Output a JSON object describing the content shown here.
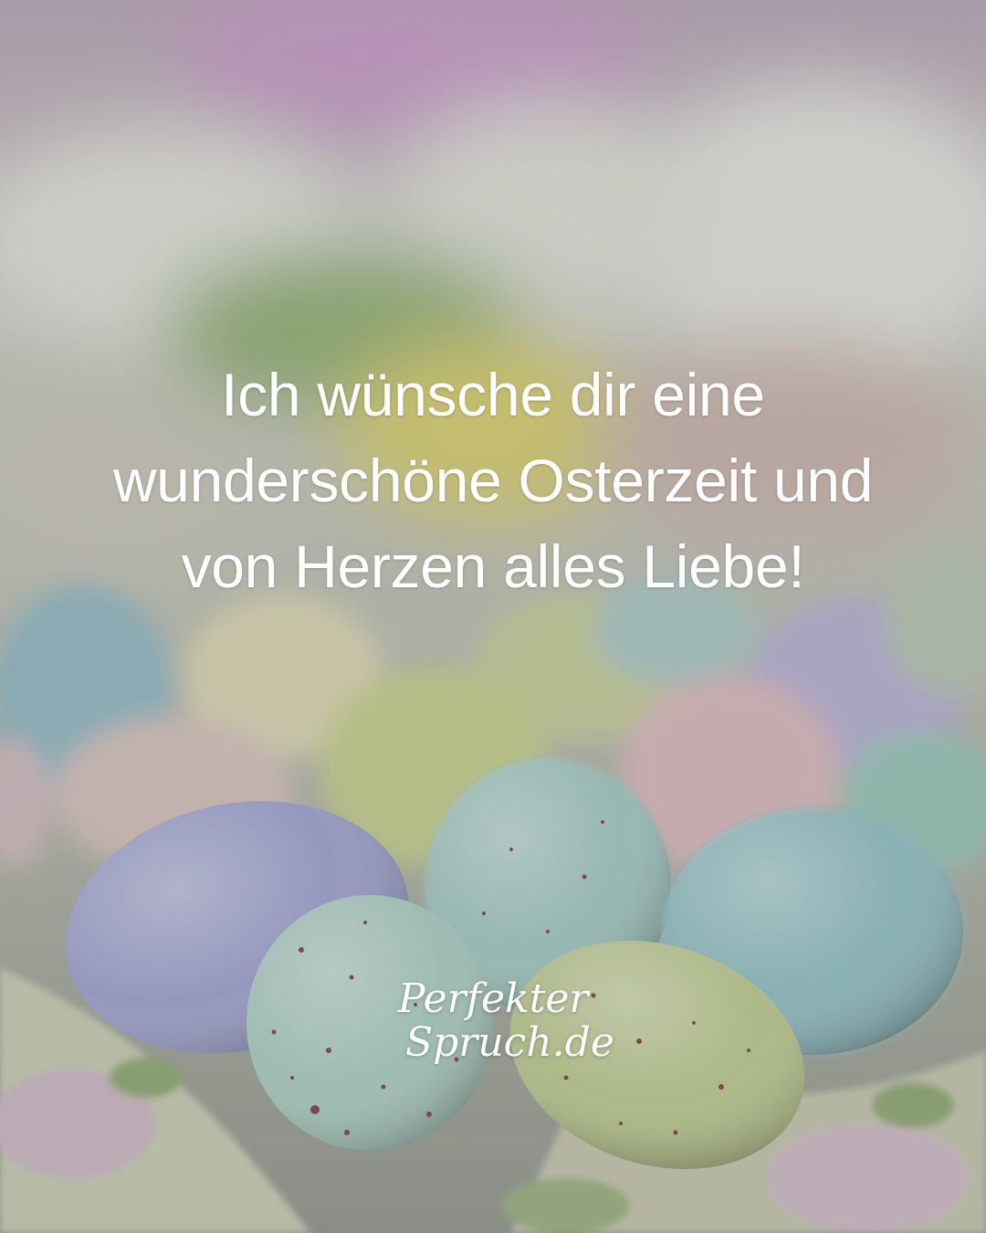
{
  "quote": {
    "lines": [
      "Ich wünsche dir eine",
      "wunderschöne Osterzeit und",
      "von Herzen alles Liebe!"
    ]
  },
  "logo": {
    "line1": "Perfekter",
    "line2": "Spruch.de"
  },
  "colors": {
    "text": "#ffffff",
    "overlay": "#7d7d7a",
    "egg_blue": "#8fb8c4",
    "egg_lilac": "#9c9fcc",
    "egg_green": "#b9c888",
    "egg_pink": "#d9b8b8",
    "egg_mint": "#9ec9bf"
  }
}
